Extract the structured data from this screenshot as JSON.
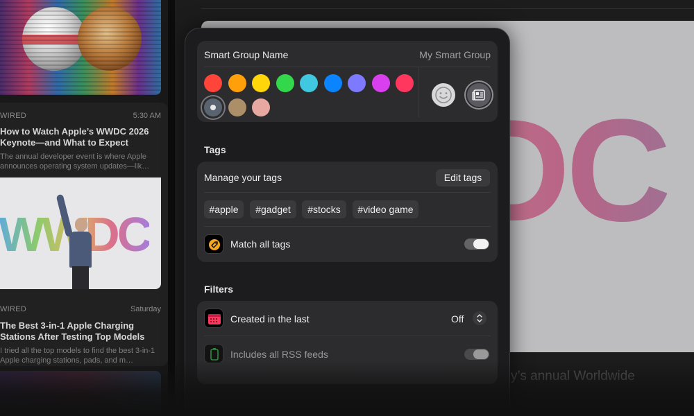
{
  "sidebar": {
    "articles": [
      {
        "source": "WIRED",
        "time": "5:30 AM",
        "headline": "How to Watch Apple’s WWDC 2026 Keynote—and What to Expect",
        "summary": "The annual developer event is where Apple announces operating system updates—lik…"
      },
      {
        "source": "WIRED",
        "time": "Saturday",
        "headline": "The Best 3-in-1 Apple Charging Stations After Testing Top Models",
        "summary": "I tried all the top models to find the best 3-in-1 Apple charging stations, pads, and m…"
      }
    ],
    "thumb_text": "WWDC"
  },
  "main": {
    "hero_text": "DC",
    "caption": "y’s annual Worldwide"
  },
  "panel": {
    "name_label": "Smart Group Name",
    "name_value": "My Smart Group",
    "colors": [
      "#ff453a",
      "#ff9f0a",
      "#ffd60a",
      "#32d74b",
      "#40c8e0",
      "#0a84ff",
      "#7d7aff",
      "#da3fef",
      "#ff375f",
      "#5a6470",
      "#ac8e68",
      "#e6a8a0"
    ],
    "selected_color_index": 9,
    "tags_title": "Tags",
    "manage_label": "Manage your tags",
    "edit_tags_label": "Edit tags",
    "tags": [
      "#apple",
      "#gadget",
      "#stocks",
      "#video game"
    ],
    "match_all_label": "Match all tags",
    "match_all_on": false,
    "filters_title": "Filters",
    "created_label": "Created in the last",
    "created_value": "Off",
    "rss_label": "Includes all RSS feeds",
    "rss_on": false
  }
}
